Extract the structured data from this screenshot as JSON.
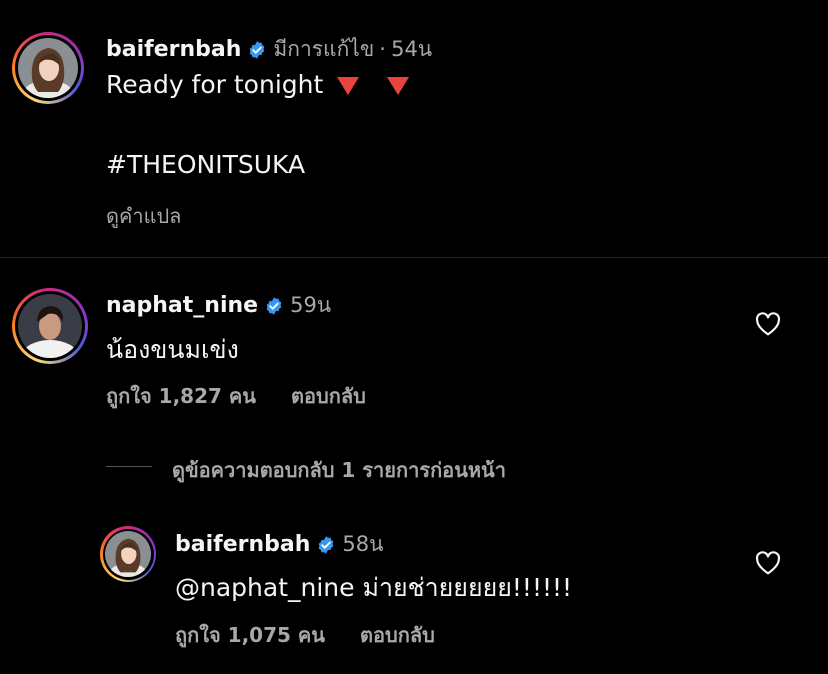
{
  "post": {
    "username": "baifernbah",
    "edited_label": "มีการแก้ไข",
    "separator": "·",
    "time": "54น",
    "caption_line1": "Ready for tonight",
    "caption_hashtag": "#THEONITSUKA",
    "translate_label": "ดูคำแปล"
  },
  "comment": {
    "username": "naphat_nine",
    "time": "59น",
    "text": "น้องขนมเข่ง",
    "likes_label": "ถูกใจ 1,827 คน",
    "reply_label": "ตอบกลับ"
  },
  "view_replies_label": "ดูข้อความตอบกลับ 1 รายการก่อนหน้า",
  "reply": {
    "username": "baifernbah",
    "time": "58น",
    "mention": "@naphat_nine",
    "text": "ม่ายช่ายยยยย!!!!!!",
    "likes_label": "ถูกใจ 1,075 คน",
    "reply_label": "ตอบกลับ"
  },
  "colors": {
    "background": "#000000",
    "verified": "#3897f0",
    "secondary_text": "#a8a8a8",
    "emoji_red": "#e8433c"
  }
}
